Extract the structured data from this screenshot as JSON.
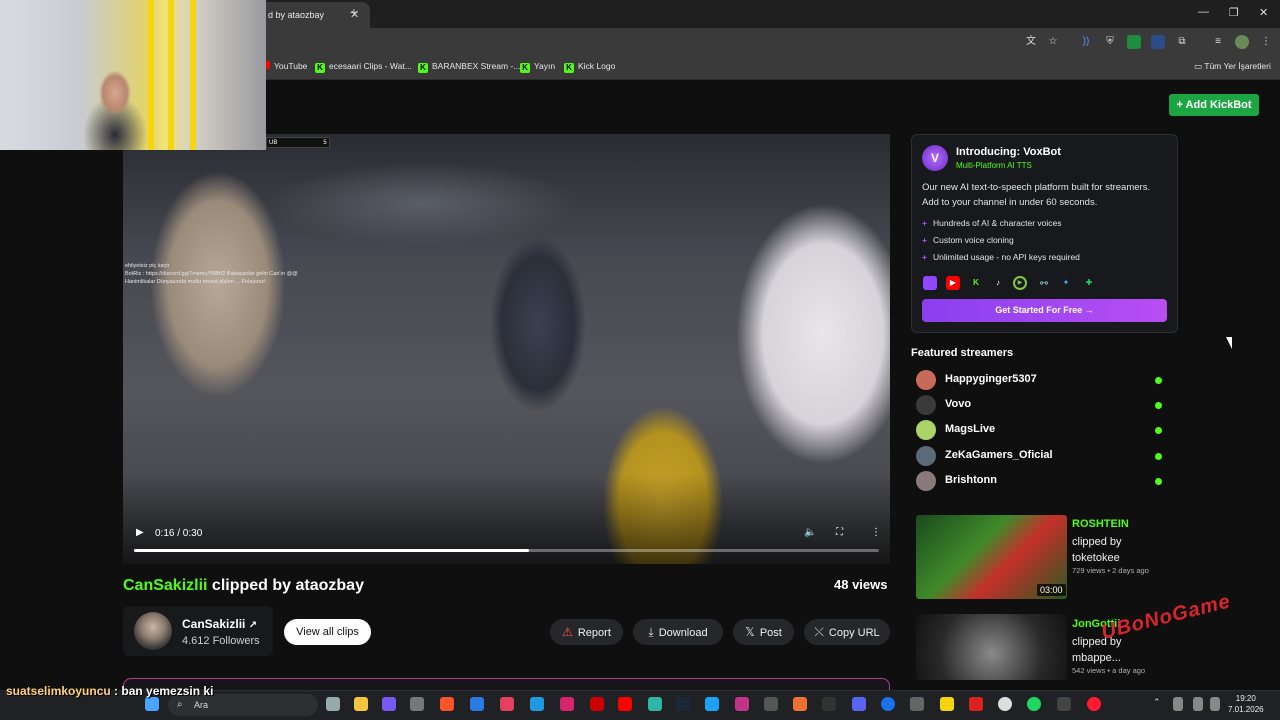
{
  "browser": {
    "tab_title": "d by ataozbay",
    "bookmarks": [
      "YouTube",
      "ecesaari Clips - Wat...",
      "BARANBEX Stream -...",
      "Yayın",
      "Kick Logo"
    ],
    "all_bookmarks": "Tüm Yer İşaretleri"
  },
  "header": {
    "add_kickbot": "+ Add KickBot"
  },
  "video": {
    "time": "0:16 / 0:30",
    "progress": 0.53,
    "overlay_lines": [
      "ehliyetsiz piç kaçtı",
      "BotRix : https://discord.gg/7memuYM8rf2 Babacanlar gelin Can'ın @@",
      "Hanimlikalar Dünyasında mutlu mesut olalım ... Fırlayınız!"
    ]
  },
  "clip": {
    "streamer": "CanSakizlii",
    "clipped_by_text": " clipped by ataozbay",
    "views": "48 views",
    "creator_name": "CanSakizlii",
    "creator_followers": "4.612 Followers",
    "view_all": "View all clips",
    "actions": {
      "report": "Report",
      "download": "Download",
      "post": "Post",
      "copy": "Copy URL"
    }
  },
  "voxbot": {
    "title": "Introducing: VoxBot",
    "subtitle": "Multi-Platform AI TTS",
    "description": "Our new AI text-to-speech platform built for streamers. Add to your channel in under 60 seconds.",
    "features": [
      "Hundreds of AI & character voices",
      "Custom voice cloning",
      "Unlimited usage - no API keys required"
    ],
    "cta": "Get Started For Free →",
    "platforms": [
      "twitch-icon",
      "youtube-icon",
      "kick-icon",
      "tiktok-icon",
      "rumble-icon",
      "link-icon",
      "bot-icon",
      "puzzle-icon"
    ]
  },
  "featured": {
    "heading": "Featured streamers",
    "streamers": [
      "Happyginger5307",
      "Vovo",
      "MagsLive",
      "ZeKaGamers_Oficial",
      "Brishtonn"
    ]
  },
  "related": [
    {
      "name": "ROSHTEIN",
      "by": "clipped by toketokee",
      "meta": "729 views • 2 days ago",
      "duration": "03:00"
    },
    {
      "name": "JonGottii",
      "by": "clipped by mbappe...",
      "meta": "542 views • a day ago"
    }
  ],
  "webcam": {
    "tag": "UB",
    "tag_num": "5"
  },
  "chat_overlay": {
    "user": "suatselimkoyuncu",
    "message": " : ban yemezsin ki"
  },
  "taskbar": {
    "search": "Ara",
    "time": "19:20",
    "date": "7.01.2026"
  },
  "brand_overlay": "UBoNoGame"
}
